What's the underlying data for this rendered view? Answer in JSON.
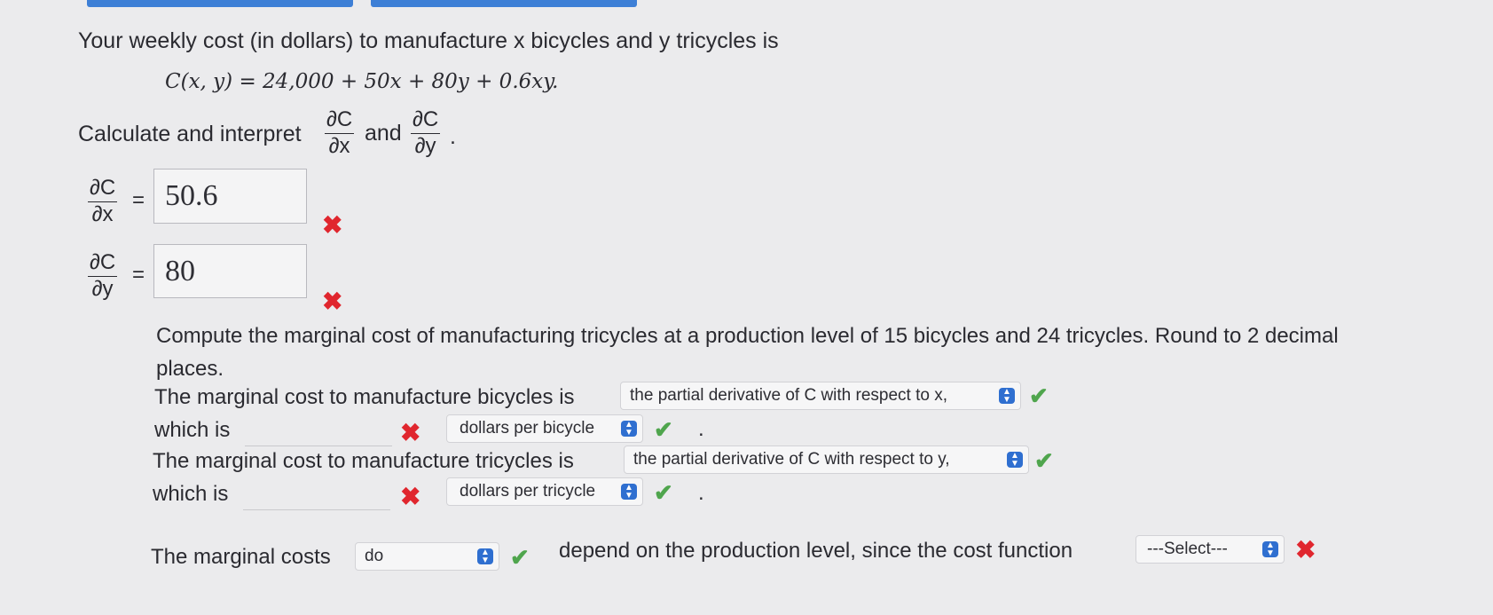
{
  "problem": {
    "intro": "Your weekly cost (in dollars) to manufacture x bicycles and y tricycles is",
    "cost_function": "C(x, y) = 24,000 + 50x + 80y + 0.6xy.",
    "instruction_prefix": "Calculate and interpret",
    "instruction_and": "and",
    "partial_num": "∂C",
    "partial_den_x": "∂x",
    "partial_den_y": "∂y",
    "period": ".",
    "equals": "="
  },
  "answers": {
    "dc_dx_value": "50.6",
    "dc_dx_status": "incorrect",
    "dc_dy_value": "80",
    "dc_dy_status": "incorrect"
  },
  "marginal": {
    "prompt_line1": "Compute the marginal cost of manufacturing tricycles at a production level of 15 bicycles and 24 tricycles. Round to 2 decimal",
    "prompt_line2": "places.",
    "bicycles_label": "The marginal cost to manufacture bicycles is",
    "bicycles_select": "the partial derivative of C with respect to x,",
    "which_is": "which is",
    "bicycle_units_select": "dollars per bicycle",
    "tricycles_label": "The marginal cost to manufacture tricycles is",
    "tricycles_select": "the partial derivative of C with respect to y,",
    "tricycle_units_select": "dollars per tricycle",
    "dot": "."
  },
  "dependence": {
    "label_prefix": "The marginal costs",
    "do_select": "do",
    "label_mid": "depend on the production level, since the cost function",
    "function_select": "---Select---"
  },
  "icons": {
    "correct": "check-icon",
    "incorrect": "x-icon",
    "select": "select-arrows-icon"
  },
  "colors": {
    "correct": "#4fa54d",
    "incorrect": "#e0262e",
    "select_icon": "#2f6fd0"
  }
}
